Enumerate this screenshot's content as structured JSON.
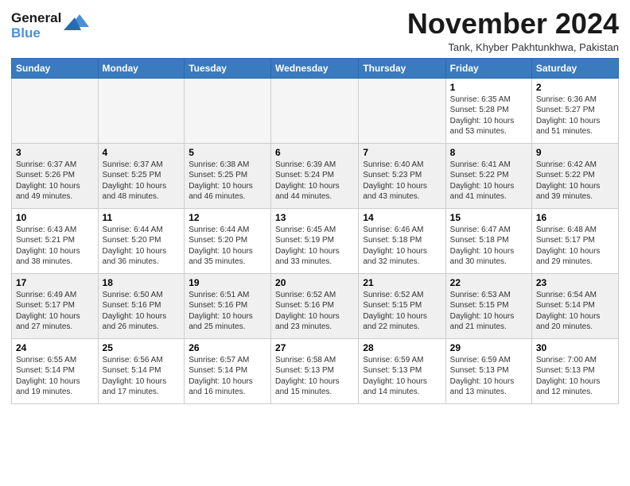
{
  "header": {
    "logo_line1": "General",
    "logo_line2": "Blue",
    "month": "November 2024",
    "location": "Tank, Khyber Pakhtunkhwa, Pakistan"
  },
  "days_of_week": [
    "Sunday",
    "Monday",
    "Tuesday",
    "Wednesday",
    "Thursday",
    "Friday",
    "Saturday"
  ],
  "weeks": [
    [
      {
        "day": "",
        "info": ""
      },
      {
        "day": "",
        "info": ""
      },
      {
        "day": "",
        "info": ""
      },
      {
        "day": "",
        "info": ""
      },
      {
        "day": "",
        "info": ""
      },
      {
        "day": "1",
        "info": "Sunrise: 6:35 AM\nSunset: 5:28 PM\nDaylight: 10 hours and 53 minutes."
      },
      {
        "day": "2",
        "info": "Sunrise: 6:36 AM\nSunset: 5:27 PM\nDaylight: 10 hours and 51 minutes."
      }
    ],
    [
      {
        "day": "3",
        "info": "Sunrise: 6:37 AM\nSunset: 5:26 PM\nDaylight: 10 hours and 49 minutes."
      },
      {
        "day": "4",
        "info": "Sunrise: 6:37 AM\nSunset: 5:25 PM\nDaylight: 10 hours and 48 minutes."
      },
      {
        "day": "5",
        "info": "Sunrise: 6:38 AM\nSunset: 5:25 PM\nDaylight: 10 hours and 46 minutes."
      },
      {
        "day": "6",
        "info": "Sunrise: 6:39 AM\nSunset: 5:24 PM\nDaylight: 10 hours and 44 minutes."
      },
      {
        "day": "7",
        "info": "Sunrise: 6:40 AM\nSunset: 5:23 PM\nDaylight: 10 hours and 43 minutes."
      },
      {
        "day": "8",
        "info": "Sunrise: 6:41 AM\nSunset: 5:22 PM\nDaylight: 10 hours and 41 minutes."
      },
      {
        "day": "9",
        "info": "Sunrise: 6:42 AM\nSunset: 5:22 PM\nDaylight: 10 hours and 39 minutes."
      }
    ],
    [
      {
        "day": "10",
        "info": "Sunrise: 6:43 AM\nSunset: 5:21 PM\nDaylight: 10 hours and 38 minutes."
      },
      {
        "day": "11",
        "info": "Sunrise: 6:44 AM\nSunset: 5:20 PM\nDaylight: 10 hours and 36 minutes."
      },
      {
        "day": "12",
        "info": "Sunrise: 6:44 AM\nSunset: 5:20 PM\nDaylight: 10 hours and 35 minutes."
      },
      {
        "day": "13",
        "info": "Sunrise: 6:45 AM\nSunset: 5:19 PM\nDaylight: 10 hours and 33 minutes."
      },
      {
        "day": "14",
        "info": "Sunrise: 6:46 AM\nSunset: 5:18 PM\nDaylight: 10 hours and 32 minutes."
      },
      {
        "day": "15",
        "info": "Sunrise: 6:47 AM\nSunset: 5:18 PM\nDaylight: 10 hours and 30 minutes."
      },
      {
        "day": "16",
        "info": "Sunrise: 6:48 AM\nSunset: 5:17 PM\nDaylight: 10 hours and 29 minutes."
      }
    ],
    [
      {
        "day": "17",
        "info": "Sunrise: 6:49 AM\nSunset: 5:17 PM\nDaylight: 10 hours and 27 minutes."
      },
      {
        "day": "18",
        "info": "Sunrise: 6:50 AM\nSunset: 5:16 PM\nDaylight: 10 hours and 26 minutes."
      },
      {
        "day": "19",
        "info": "Sunrise: 6:51 AM\nSunset: 5:16 PM\nDaylight: 10 hours and 25 minutes."
      },
      {
        "day": "20",
        "info": "Sunrise: 6:52 AM\nSunset: 5:16 PM\nDaylight: 10 hours and 23 minutes."
      },
      {
        "day": "21",
        "info": "Sunrise: 6:52 AM\nSunset: 5:15 PM\nDaylight: 10 hours and 22 minutes."
      },
      {
        "day": "22",
        "info": "Sunrise: 6:53 AM\nSunset: 5:15 PM\nDaylight: 10 hours and 21 minutes."
      },
      {
        "day": "23",
        "info": "Sunrise: 6:54 AM\nSunset: 5:14 PM\nDaylight: 10 hours and 20 minutes."
      }
    ],
    [
      {
        "day": "24",
        "info": "Sunrise: 6:55 AM\nSunset: 5:14 PM\nDaylight: 10 hours and 19 minutes."
      },
      {
        "day": "25",
        "info": "Sunrise: 6:56 AM\nSunset: 5:14 PM\nDaylight: 10 hours and 17 minutes."
      },
      {
        "day": "26",
        "info": "Sunrise: 6:57 AM\nSunset: 5:14 PM\nDaylight: 10 hours and 16 minutes."
      },
      {
        "day": "27",
        "info": "Sunrise: 6:58 AM\nSunset: 5:13 PM\nDaylight: 10 hours and 15 minutes."
      },
      {
        "day": "28",
        "info": "Sunrise: 6:59 AM\nSunset: 5:13 PM\nDaylight: 10 hours and 14 minutes."
      },
      {
        "day": "29",
        "info": "Sunrise: 6:59 AM\nSunset: 5:13 PM\nDaylight: 10 hours and 13 minutes."
      },
      {
        "day": "30",
        "info": "Sunrise: 7:00 AM\nSunset: 5:13 PM\nDaylight: 10 hours and 12 minutes."
      }
    ]
  ]
}
